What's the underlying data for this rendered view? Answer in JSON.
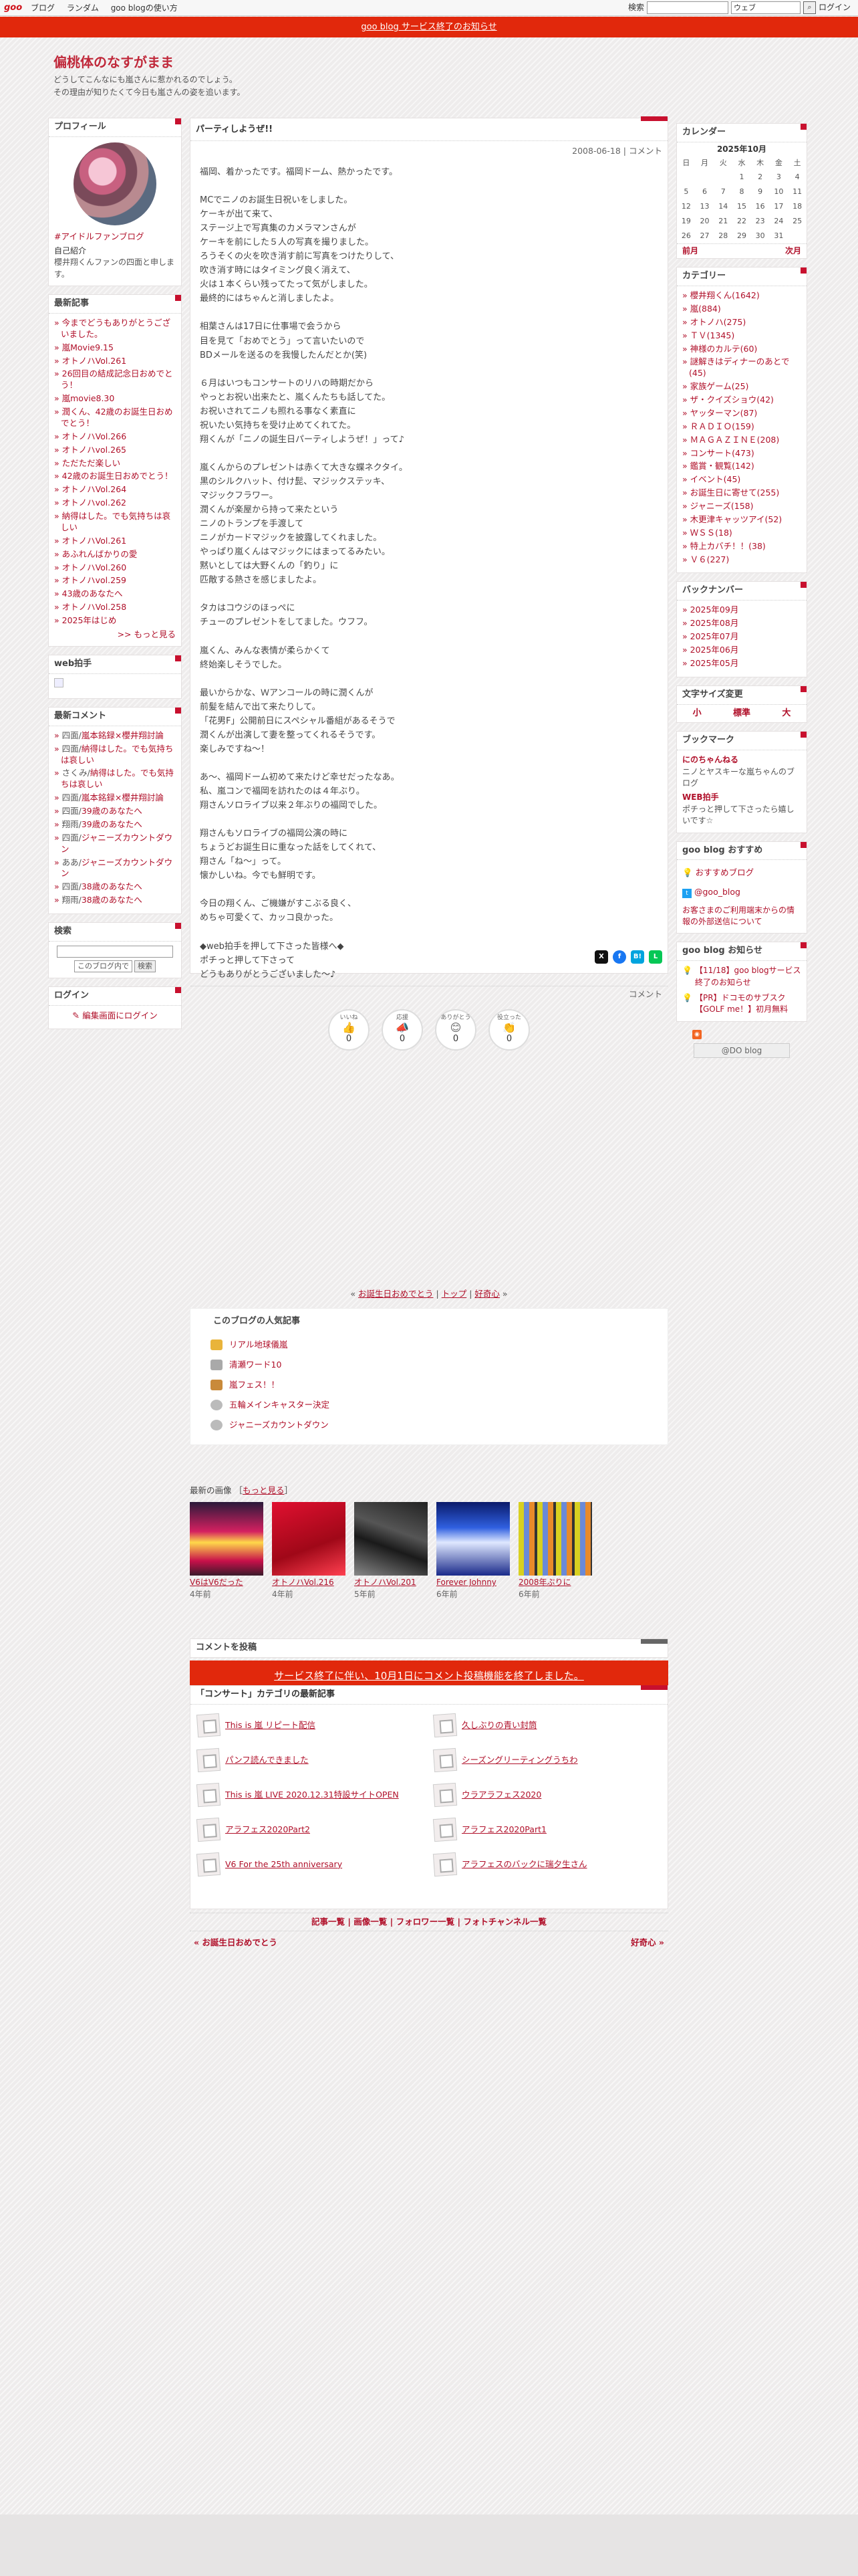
{
  "topbar": {
    "logo": "goo",
    "links": [
      "ブログ",
      "ランダム",
      "goo blogの使い方"
    ],
    "search_label": "検索",
    "search_select": "ウェブ",
    "login": "ログイン"
  },
  "notice": "goo blog サービス終了のお知らせ",
  "blog": {
    "title": "偏桃体のなすがまま",
    "desc1": "どうしてこんなにも嵐さんに惹かれるのでしょう。",
    "desc2": "その理由が知りたくて今日も嵐さんの姿を追います。"
  },
  "profile": {
    "title": "プロフィール",
    "caption": "#アイドルファンブログ",
    "intro_label": "自己紹介",
    "intro": "櫻井翔くんファンの四面と申します。"
  },
  "recent": {
    "title": "最新記事",
    "items": [
      "今までどうもありがとうございました。",
      "嵐Movie9.15",
      "オトノハVol.261",
      "26回目の結成記念日おめでとう！",
      "嵐movie8.30",
      "潤くん、42歳のお誕生日おめでとう！",
      "オトノハVol.266",
      "オトノハvol.265",
      "ただただ楽しい",
      "42歳のお誕生日おめでとう！",
      "オトノハVol.264",
      "オトノハvol.262",
      "納得はした。でも気持ちは哀しい",
      "オトノハVol.261",
      "あふれんばかりの愛",
      "オトノハVol.260",
      "オトノハvol.259",
      "43歳のあなたへ",
      "オトノハVol.258",
      "2025年はじめ"
    ],
    "more": ">> もっと見る"
  },
  "webclap": {
    "title": "web拍手"
  },
  "comments": {
    "title": "最新コメント",
    "items": [
      {
        "who": "四面/",
        "on": "嵐本銘録×櫻井翔討論"
      },
      {
        "who": "四面/",
        "on": "納得はした。でも気持ちは哀しい"
      },
      {
        "who": "さくみ/",
        "on": "納得はした。でも気持ちは哀しい"
      },
      {
        "who": "四面/",
        "on": "嵐本銘録×櫻井翔討論"
      },
      {
        "who": "四面/",
        "on": "39歳のあなたへ"
      },
      {
        "who": "翔雨/",
        "on": "39歳のあなたへ"
      },
      {
        "who": "四面/",
        "on": "ジャニーズカウントダウン"
      },
      {
        "who": "ああ/",
        "on": "ジャニーズカウントダウン"
      },
      {
        "who": "四面/",
        "on": "38歳のあなたへ"
      },
      {
        "who": "翔雨/",
        "on": "38歳のあなたへ"
      }
    ]
  },
  "search": {
    "title": "検索",
    "scope": "このブログ内で",
    "button": "検索"
  },
  "login": {
    "title": "ログイン",
    "link": "編集画面にログイン"
  },
  "post": {
    "title": "パーティしようぜ!!",
    "date": "2008-06-18",
    "sep": "|",
    "comment": "コメント",
    "body": "福岡、着かったです。福岡ドーム、熱かったです。\n\nMCでニノのお誕生日祝いをしました。\nケーキが出て来て、\nステージ上で写真集のカメラマンさんが\nケーキを前にした５人の写真を撮りました。\nろうそくの火を吹き消す前に写真をつけたりして、\n吹き消す時にはタイミング良く消えて、\n火は１本くらい残ってたって気がしました。\n最終的にはちゃんと消しましたよ。\n\n相葉さんは17日に仕事場で会うから\n目を見て「おめでとう」って言いたいので\nBDメールを送るのを我慢したんだとか(笑)\n\n６月はいつもコンサートのリハの時期だから\nやっとお祝い出来たと、嵐くんたちも話してた。\nお祝いされてニノも照れる事なく素直に\n祝いたい気持ちを受け止めてくれてた。\n翔くんが「ニノの誕生日パーティしようぜ！」って♪\n\n嵐くんからのプレゼントは赤くて大きな蝶ネクタイ。\n黒のシルクハット、付け髭、マジックステッキ、\nマジックフラワー。\n潤くんが楽屋から持って来たという\nニノのトランプを手渡して\nニノがカードマジックを披露してくれました。\nやっぱり嵐くんはマジックにはまってるみたい。\n黙いとしては大野くんの「釣り」に\n匹敵する熱さを感じましたよ。\n\nタカはコウジのほっぺに\nチューのプレゼントをしてました。ウフフ。\n\n嵐くん、みんな表情が柔らかくて\n終始楽しそうでした。\n\n最いからかな、Ｗアンコールの時に潤くんが\n前髪を結んで出て来たりして。\n「花男F」公開前日にスペシャル番組があるそうで\n潤くんが出演して妻を整ってくれるそうです。\n楽しみですね～！\n\nあ～、福岡ドーム初めて来たけど幸せだったなあ。\n私、嵐コンで福岡を訪れたのは４年ぶり。\n翔さんソロライブ以来２年ぶりの福岡でした。\n\n翔さんもソロライブの福岡公演の時に\nちょうどお誕生日に重なった話をしてくれて、\n翔さん「ね～」って。\n懐かしいね。今でも鮮明です。\n\n今日の翔くん、ご機嫌がすこぶる良く、\nめちゃ可愛くて、カッコ良かった。\n\n◆web拍手を押して下さった皆様へ◆\nポチっと押して下さって\nどうもありがとうございました～♪",
    "footer": "コメント",
    "reactions": [
      {
        "label": "いいね",
        "icon": "👍",
        "count": "0"
      },
      {
        "label": "応援",
        "icon": "📣",
        "count": "0"
      },
      {
        "label": "ありがとう",
        "icon": "😊",
        "count": "0"
      },
      {
        "label": "役立った",
        "icon": "👏",
        "count": "0"
      }
    ]
  },
  "calendar": {
    "title": "カレンダー",
    "month": "2025年10月",
    "days": [
      "日",
      "月",
      "火",
      "水",
      "木",
      "金",
      "土"
    ],
    "weeks": [
      [
        "",
        "",
        "",
        "1",
        "2",
        "3",
        "4"
      ],
      [
        "5",
        "6",
        "7",
        "8",
        "9",
        "10",
        "11"
      ],
      [
        "12",
        "13",
        "14",
        "15",
        "16",
        "17",
        "18"
      ],
      [
        "19",
        "20",
        "21",
        "22",
        "23",
        "24",
        "25"
      ],
      [
        "26",
        "27",
        "28",
        "29",
        "30",
        "31",
        ""
      ]
    ],
    "prev": "前月",
    "next": "次月"
  },
  "categories": {
    "title": "カテゴリー",
    "items": [
      "櫻井翔くん(1642)",
      "嵐(884)",
      "オトノハ(275)",
      "ＴＶ(1345)",
      "神様のカルテ(60)",
      "謎解きはディナーのあとで(45)",
      "家族ゲーム(25)",
      "ザ・クイズショウ(42)",
      "ヤッターマン(87)",
      "ＲＡＤＩＯ(159)",
      "ＭＡＧＡＺＩＮＥ(208)",
      "コンサート(473)",
      "鑑賞・観覧(142)",
      "イベント(45)",
      "お誕生日に寄せて(255)",
      "ジャニーズ(158)",
      "木更津キャッツアイ(52)",
      "ＷＳＳ(18)",
      "特上カバチ！！(38)",
      "Ｖ６(227)"
    ]
  },
  "backnumber": {
    "title": "バックナンバー",
    "items": [
      "2025年09月",
      "2025年08月",
      "2025年07月",
      "2025年06月",
      "2025年05月"
    ]
  },
  "fontsize": {
    "title": "文字サイズ変更",
    "small": "小",
    "medium": "標準",
    "large": "大"
  },
  "bookmark": {
    "title": "ブックマーク",
    "items": [
      {
        "name": "にのちゃんねる",
        "desc": "ニノとヤスキーな嵐ちゃんのブログ"
      },
      {
        "name": "WEB拍手",
        "desc": "ポチっと押して下さったら嬉しいです☆"
      }
    ]
  },
  "goorec": {
    "title": "goo blog おすすめ",
    "items": [
      "おすすめブログ",
      "@goo_blog"
    ],
    "note": "お客さまのご利用端末からの情報の外部送信について"
  },
  "goonews": {
    "title": "goo blog お知らせ",
    "items": [
      "【11/18】goo blogサービス終了のお知らせ",
      "【PR】ドコモのサブスク【GOLF me！】初月無料"
    ]
  },
  "footer_badge": "@DO blog",
  "nav": {
    "prev": "お誕生日おめでとう",
    "top": "トップ",
    "next": "好奇心"
  },
  "popular": {
    "title": "このブログの人気記事",
    "items": [
      "リアル地球儀嵐",
      "清瀬ワード10",
      "嵐フェス！！",
      "五輪メインキャスター決定",
      "ジャニーズカウントダウン"
    ]
  },
  "images": {
    "title": "最新の画像",
    "more": "もっと見る",
    "items": [
      {
        "cap": "V6はV6だった",
        "yr": "4年前"
      },
      {
        "cap": "オトノハVol.216",
        "yr": "4年前"
      },
      {
        "cap": "オトノハVol.201",
        "yr": "5年前"
      },
      {
        "cap": "Forever Johnny",
        "yr": "6年前"
      },
      {
        "cap": "2008年ぶりに",
        "yr": "6年前"
      }
    ]
  },
  "comment_post": {
    "title": "コメントを投稿",
    "banner": "サービス終了に伴い、10月1日にコメント投稿機能を終了しました。"
  },
  "catnew": {
    "title": "「コンサート」カテゴリの最新記事",
    "items": [
      "This is 嵐 リピート配信",
      "久しぶりの青い封筒",
      "パンフ読んできました",
      "シーズングリーティングうちわ",
      "This is 嵐 LIVE 2020.12.31特設サイトOPEN",
      "ウラアラフェス2020",
      "アラフェス2020Part2",
      "アラフェス2020Part1",
      "V6 For the 25th anniversary",
      "アラフェスのバックに瑞夕生さん"
    ]
  },
  "bottom": {
    "links": [
      "記事一覧",
      "画像一覧",
      "フォロワー一覧",
      "フォトチャンネル一覧"
    ],
    "prev": "« お誕生日おめでとう",
    "next": "好奇心 »"
  }
}
